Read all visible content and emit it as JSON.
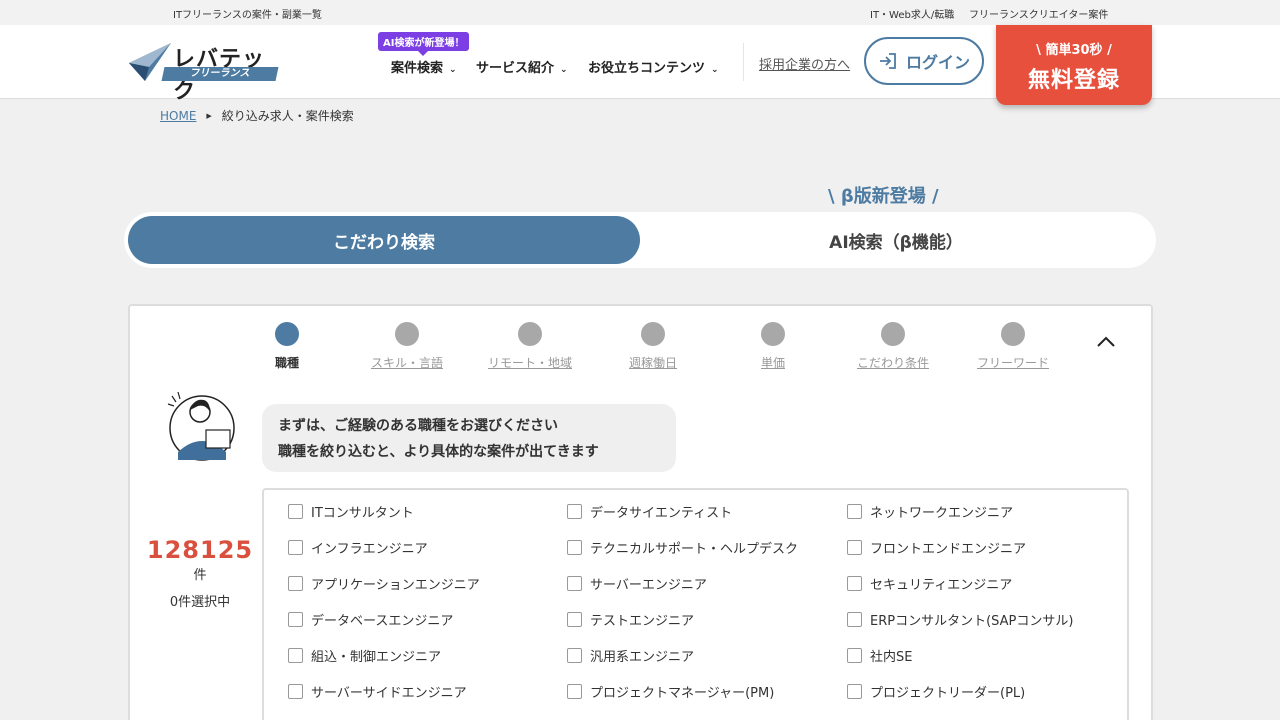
{
  "topbar": {
    "left": "ITフリーランスの案件・副業一覧",
    "right1": "IT・Web求人/転職",
    "right2": "フリーランスクリエイター案件"
  },
  "header": {
    "logo_text": "レバテック",
    "logo_sub": "フリーランス",
    "ai_badge": "AI検索が新登場！",
    "nav": [
      "案件検索",
      "サービス紹介",
      "お役立ちコンテンツ"
    ],
    "recruit_link": "採用企業の方へ",
    "login_label": "ログイン",
    "register_top": "\\ 簡単30秒 /",
    "register_label": "無料登録",
    "accent_color": "#4d7ba2",
    "register_color": "#e8503e"
  },
  "breadcrumb": {
    "home": "HOME",
    "current": "絞り込み求人・案件検索"
  },
  "beta_label": "\\ β版新登場 /",
  "tabs": {
    "active": "こだわり検索",
    "ai": "AI検索（β機能）"
  },
  "steps": [
    "職種",
    "スキル・言語",
    "リモート・地域",
    "週稼働日",
    "単価",
    "こだわり条件",
    "フリーワード"
  ],
  "bubble": {
    "line1": "まずは、ご経験のある職種をお選びください",
    "line2": "職種を絞り込むと、より具体的な案件が出てきます"
  },
  "count": {
    "number": "128125",
    "unit": "件",
    "selected": "0件選択中"
  },
  "jobs": [
    [
      "ITコンサルタント",
      "データサイエンティスト",
      "ネットワークエンジニア"
    ],
    [
      "インフラエンジニア",
      "テクニカルサポート・ヘルプデスク",
      "フロントエンドエンジニア"
    ],
    [
      "アプリケーションエンジニア",
      "サーバーエンジニア",
      "セキュリティエンジニア"
    ],
    [
      "データベースエンジニア",
      "テストエンジニア",
      "ERPコンサルタント(SAPコンサル)"
    ],
    [
      "組込・制御エンジニア",
      "汎用系エンジニア",
      "社内SE"
    ],
    [
      "サーバーサイドエンジニア",
      "プロジェクトマネージャー(PM)",
      "プロジェクトリーダー(PL)"
    ]
  ]
}
